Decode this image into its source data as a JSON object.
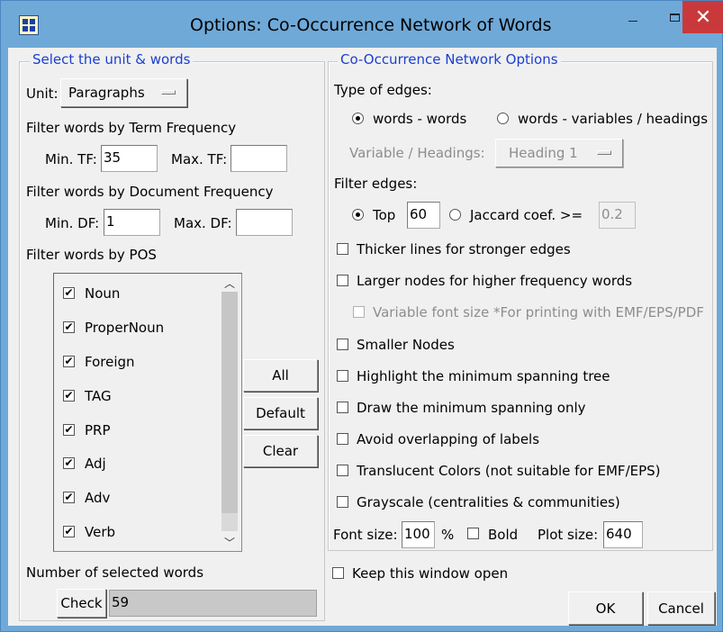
{
  "window": {
    "title": "Options: Co-Occurrence Network of Words",
    "minimize_icon": "minimize-icon",
    "maximize_icon": "maximize-icon",
    "close_glyph": "✕",
    "close_color": "#c9393c"
  },
  "left": {
    "group_label": "Select the unit & words",
    "unit_label": "Unit:",
    "unit_value": "Paragraphs",
    "tf_heading": "Filter words by Term Frequency",
    "min_tf_label": "Min. TF:",
    "min_tf_value": "35",
    "max_tf_label": "Max. TF:",
    "max_tf_value": "",
    "df_heading": "Filter words by Document Frequency",
    "min_df_label": "Min. DF:",
    "min_df_value": "1",
    "max_df_label": "Max. DF:",
    "max_df_value": "",
    "pos_heading": "Filter words by POS",
    "pos_items": [
      {
        "label": "Noun",
        "checked": true
      },
      {
        "label": "ProperNoun",
        "checked": true
      },
      {
        "label": "Foreign",
        "checked": true
      },
      {
        "label": "TAG",
        "checked": true
      },
      {
        "label": "PRP",
        "checked": true
      },
      {
        "label": "Adj",
        "checked": true
      },
      {
        "label": "Adv",
        "checked": true
      },
      {
        "label": "Verb",
        "checked": true
      }
    ],
    "btn_all": "All",
    "btn_default": "Default",
    "btn_clear": "Clear",
    "selected_heading": "Number of selected words",
    "check_button": "Check",
    "selected_count": "59"
  },
  "right": {
    "group_label": "Co-Occurrence Network Options",
    "edge_type_heading": "Type of edges:",
    "edge_words_words": "words - words",
    "edge_words_vars": "words - variables / headings",
    "edge_type_selected": "words - words",
    "variable_label": "Variable / Headings:",
    "variable_value": "Heading 1",
    "filter_edges_heading": "Filter edges:",
    "top_label": "Top",
    "top_value": "60",
    "jaccard_label": "Jaccard coef. >=",
    "jaccard_value": "0.2",
    "filter_edges_selected": "Top",
    "options": [
      {
        "label": "Thicker lines for stronger edges",
        "checked": false,
        "disabled": false
      },
      {
        "label": "Larger nodes for higher frequency words",
        "checked": false,
        "disabled": false
      },
      {
        "label": "Variable font size *For printing with EMF/EPS/PDF",
        "checked": false,
        "disabled": true
      },
      {
        "label": "Smaller Nodes",
        "checked": false,
        "disabled": false
      },
      {
        "label": "Highlight the minimum spanning tree",
        "checked": false,
        "disabled": false
      },
      {
        "label": "Draw the minimum spanning only",
        "checked": false,
        "disabled": false
      },
      {
        "label": "Avoid overlapping of labels",
        "checked": false,
        "disabled": false
      },
      {
        "label": "Translucent Colors (not suitable for EMF/EPS)",
        "checked": false,
        "disabled": false
      },
      {
        "label": "Grayscale (centralities & communities)",
        "checked": false,
        "disabled": false
      }
    ],
    "font_size_label": "Font size:",
    "font_size_value": "100",
    "percent_label": "%",
    "bold_label": "Bold",
    "bold_checked": false,
    "plot_size_label": "Plot size:",
    "plot_size_value": "640"
  },
  "footer": {
    "keep_open_label": "Keep this window open",
    "keep_open_checked": false,
    "ok_button": "OK",
    "cancel_button": "Cancel"
  },
  "colors": {
    "title_bar": "#6fa9d8",
    "group_label_blue": "#1a3fd0",
    "face": "#f0f0f0",
    "disabled_text": "#8d8d8d"
  }
}
